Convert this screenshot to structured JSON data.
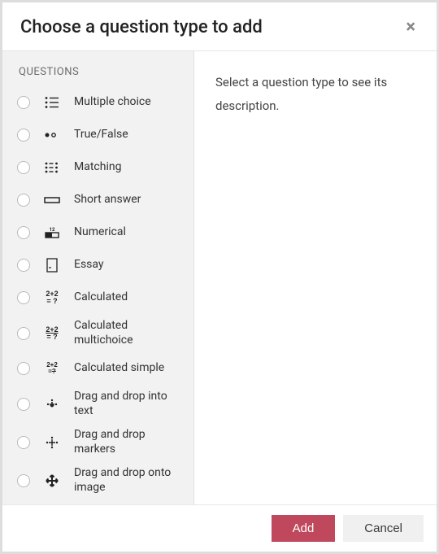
{
  "header": {
    "title": "Choose a question type to add",
    "close_label": "×"
  },
  "sidebar": {
    "heading": "QUESTIONS",
    "items": [
      {
        "label": "Multiple choice"
      },
      {
        "label": "True/False"
      },
      {
        "label": "Matching"
      },
      {
        "label": "Short answer"
      },
      {
        "label": "Numerical"
      },
      {
        "label": "Essay"
      },
      {
        "label": "Calculated"
      },
      {
        "label": "Calculated multichoice"
      },
      {
        "label": "Calculated simple"
      },
      {
        "label": "Drag and drop into text"
      },
      {
        "label": "Drag and drop markers"
      },
      {
        "label": "Drag and drop onto image"
      }
    ]
  },
  "description": {
    "placeholder": "Select a question type to see its description."
  },
  "footer": {
    "add_label": "Add",
    "cancel_label": "Cancel"
  },
  "colors": {
    "primary": "#c0485c"
  }
}
